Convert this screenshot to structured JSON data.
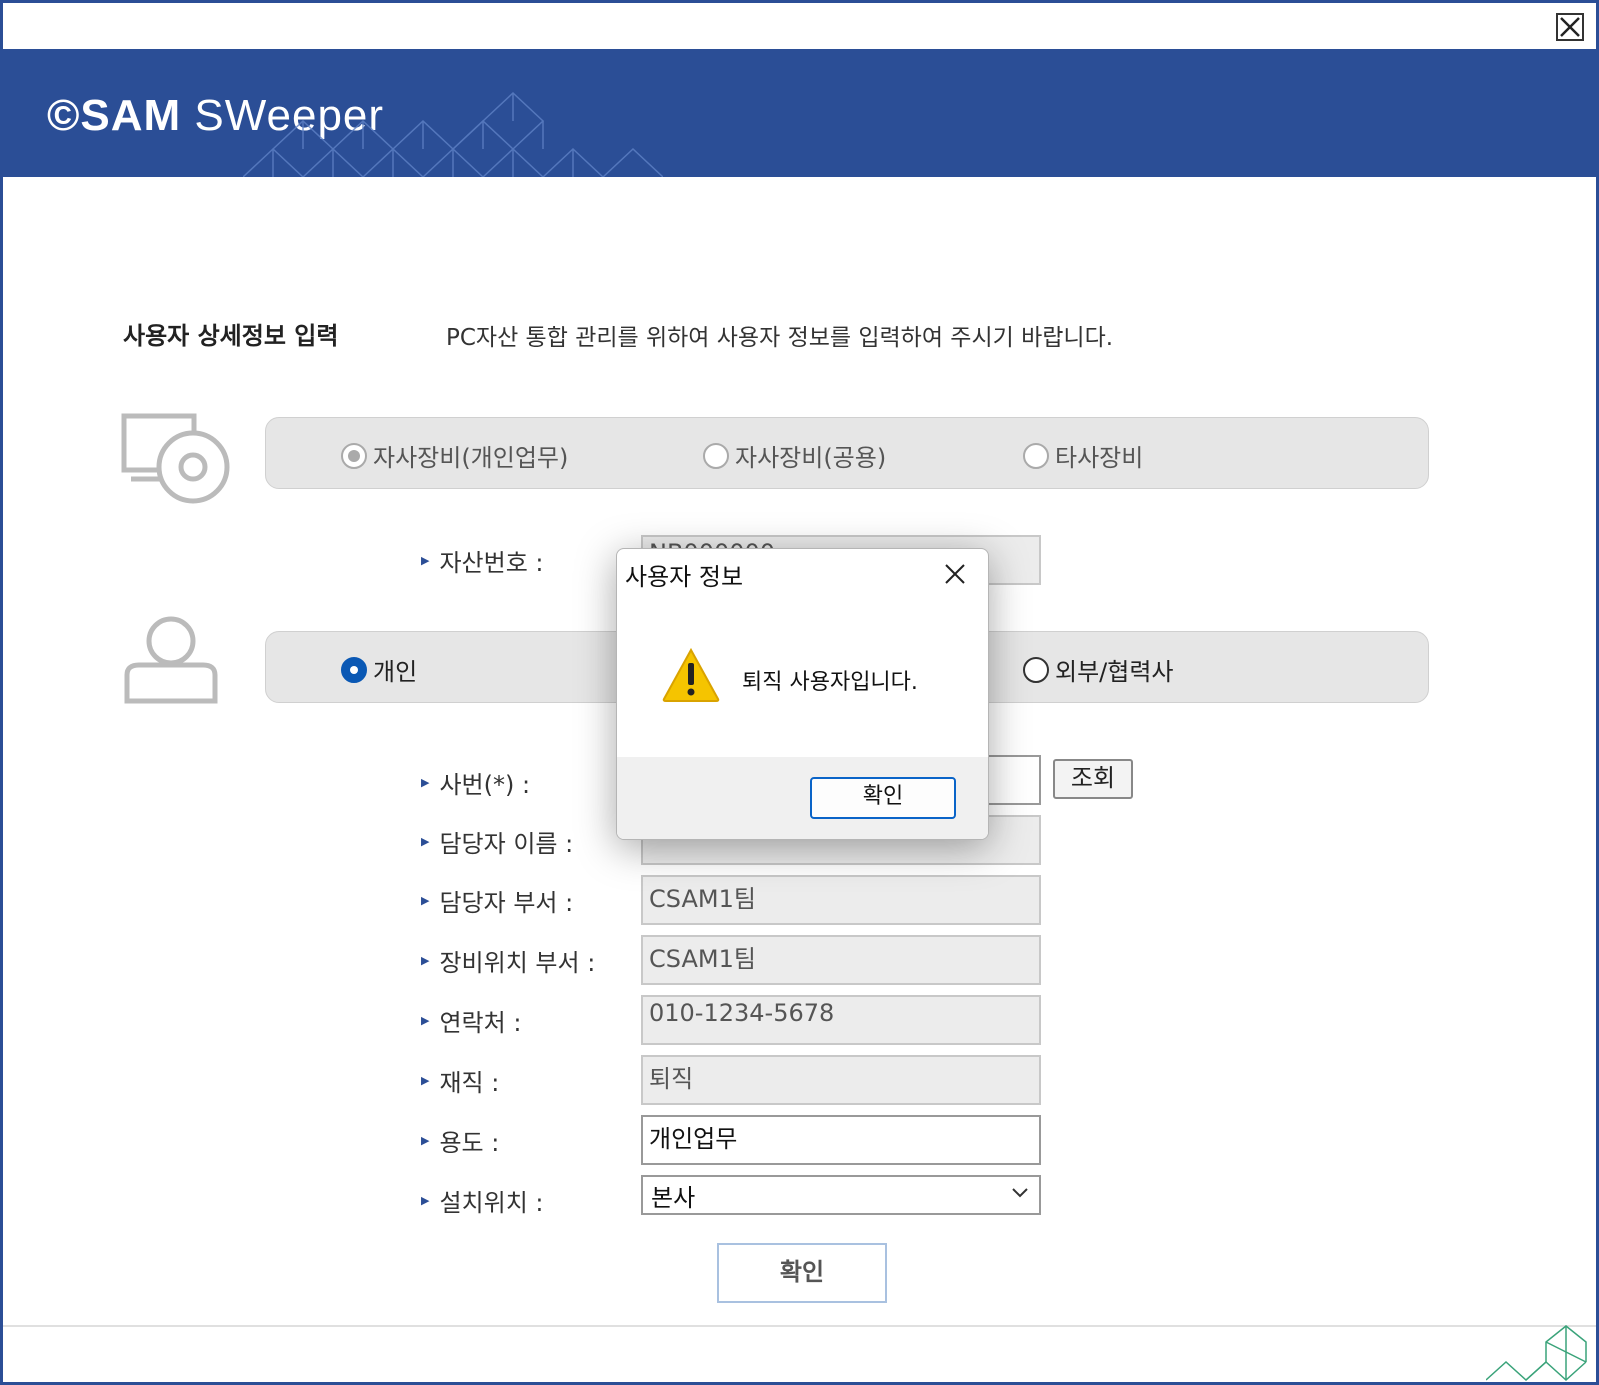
{
  "window": {
    "close_icon": "close-box-icon"
  },
  "banner": {
    "logo_mark": "©",
    "logo_bold": "SAM",
    "logo_light": " SWeeper"
  },
  "header": {
    "heading": "사용자 상세정보 입력",
    "description": "PC자산 통합 관리를 위하여 사용자 정보를 입력하여 주시기 바랍니다."
  },
  "equipment_type": {
    "options": [
      "자사장비(개인업무)",
      "자사장비(공용)",
      "타사장비"
    ],
    "selected": "자사장비(개인업무)"
  },
  "asset": {
    "label": "자산번호 :",
    "value": "NB000000"
  },
  "user_type": {
    "options": [
      "개인",
      "외부/협력사"
    ],
    "selected": "개인"
  },
  "form": {
    "employee_id_label": "사번(*) :",
    "lookup_button": "조회",
    "name_label": "담당자 이름 :",
    "name_value": "",
    "dept_label": "담당자 부서 :",
    "dept_value": "CSAM1팀",
    "location_dept_label": "장비위치 부서 :",
    "location_dept_value": "CSAM1팀",
    "contact_label": "연락처 :",
    "contact_value": "010-1234-5678",
    "employment_label": "재직 :",
    "employment_value": "퇴직",
    "usage_label": "용도 :",
    "usage_value": "개인업무",
    "install_label": "설치위치 :",
    "install_value": "본사"
  },
  "main_ok": "확인",
  "dialog": {
    "title": "사용자 정보",
    "message": "퇴직 사용자입니다.",
    "ok": "확인"
  },
  "colors": {
    "brand": "#2b4e96",
    "accent": "#0a58b4",
    "warning": "#f5c400"
  }
}
